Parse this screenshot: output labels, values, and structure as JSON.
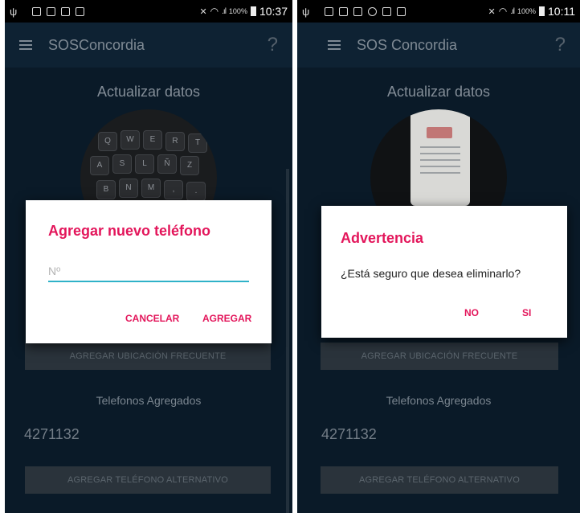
{
  "status_bar_left": {
    "time": "10:37",
    "battery_pct": "100%",
    "signal": ".ıl"
  },
  "status_bar_right": {
    "time": "10:11",
    "battery_pct": "100%",
    "signal": ".ıl"
  },
  "app": {
    "title_left": "SOSConcordia",
    "title_right": "SOS Concordia",
    "help": "?"
  },
  "page": {
    "title": "Actualizar datos",
    "add_frequent_location_button": "AGREGAR UBICACIÓN FRECUENTE",
    "added_phones_label": "Telefonos Agregados",
    "phones": [
      "4271132"
    ],
    "add_alternative_phone_button": "AGREGAR TELÉFONO ALTERNATIVO"
  },
  "dialog_add_phone": {
    "title": "Agregar nuevo teléfono",
    "input_placeholder": "Nº",
    "input_value": "",
    "cancel_label": "CANCELAR",
    "confirm_label": "AGREGAR"
  },
  "dialog_warning": {
    "title": "Advertencia",
    "message": "¿Está seguro que desea eliminarlo?",
    "no_label": "NO",
    "yes_label": "SI"
  },
  "colors": {
    "accent": "#e3165b",
    "input_underline": "#2fb2c8",
    "background": "#0a1a28",
    "app_bar": "#0e2233"
  }
}
